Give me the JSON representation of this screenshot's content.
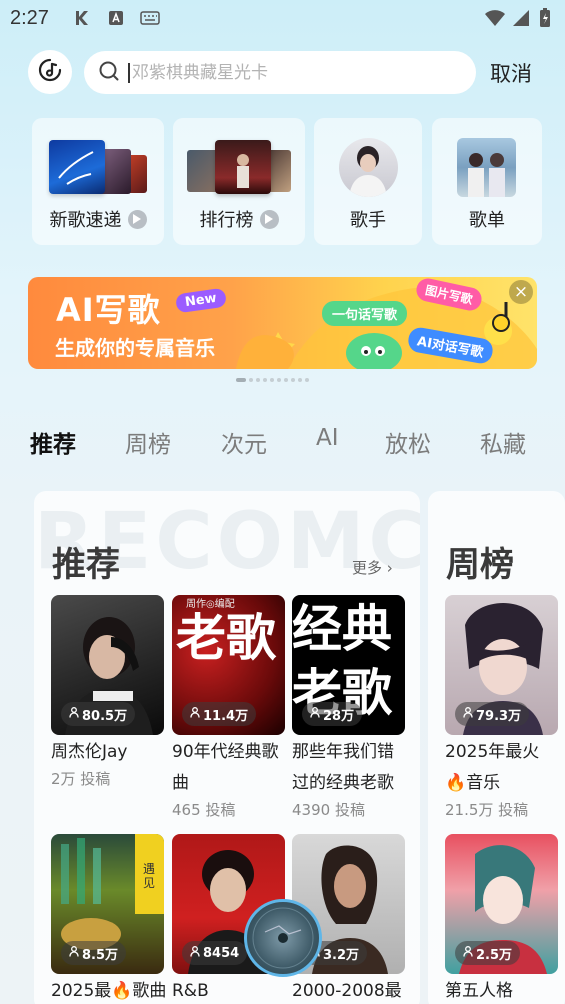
{
  "status_bar": {
    "time": "2:27",
    "icons": [
      "k-app-icon",
      "a-box-icon",
      "keyboard-icon",
      "wifi-icon",
      "signal-icon",
      "battery-charging-icon"
    ]
  },
  "header": {
    "logo_icon": "music-recognize-icon",
    "search_placeholder": "邓紫棋典藏星光卡",
    "cancel_label": "取消"
  },
  "quick_links": [
    {
      "label": "新歌速递",
      "has_play": true
    },
    {
      "label": "排行榜",
      "has_play": true
    },
    {
      "label": "歌手",
      "has_play": false
    },
    {
      "label": "歌单",
      "has_play": false
    }
  ],
  "banner": {
    "title": "AI写歌",
    "subtitle": "生成你的专属音乐",
    "badge_new": "New",
    "chip1": "一句话写歌",
    "chip2": "图片写歌",
    "chip3": "AI对话写歌",
    "close": "×",
    "total_pages": 10,
    "active_page": 1
  },
  "tabs": [
    "推荐",
    "周榜",
    "次元",
    "AI",
    "放松",
    "私藏"
  ],
  "active_tab": "推荐",
  "recommend": {
    "watermark": "RECOMCH",
    "title": "推荐",
    "more_label": "更多",
    "items": [
      {
        "count": "80.5万",
        "title": "周杰伦Jay",
        "sub": "2万 投稿"
      },
      {
        "count": "11.4万",
        "title": "90年代经典歌曲",
        "sub": "465 投稿"
      },
      {
        "count": "28万",
        "title": "那些年我们错过的经典老歌",
        "sub": "4390 投稿"
      },
      {
        "count": "8.5万",
        "title": "2025最🔥歌曲",
        "sub": ""
      },
      {
        "count": "8454",
        "title": "R&B",
        "sub": ""
      },
      {
        "count": "3.2万",
        "title": "2000-2008最",
        "sub": ""
      }
    ],
    "cover_texts": {
      "c2_main": "老歌",
      "c2_tag": "周作◎编配",
      "c3": "经典老歌",
      "c4": "遇见"
    }
  },
  "weekly": {
    "title": "周榜",
    "items": [
      {
        "count": "79.3万",
        "title": "2025年最火🔥音乐",
        "sub": "21.5万 投稿"
      },
      {
        "count": "2.5万",
        "title": "第五人格",
        "sub": ""
      }
    ]
  }
}
